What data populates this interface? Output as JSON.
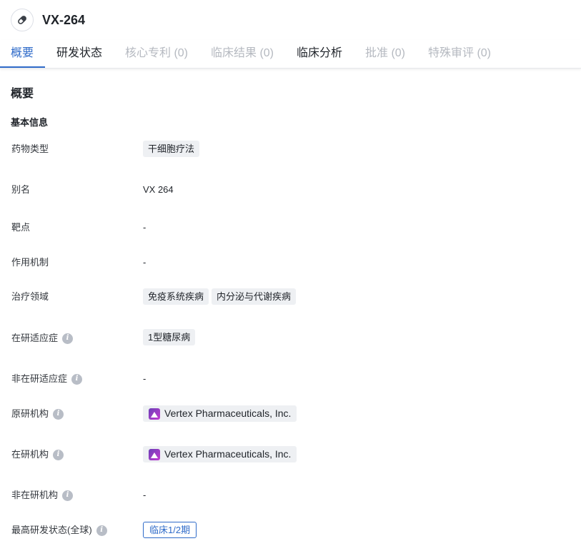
{
  "drug": {
    "name": "VX-264",
    "icon": "pill-icon"
  },
  "tabs": [
    {
      "label": "概要",
      "state": "active"
    },
    {
      "label": "研发状态",
      "state": "normal"
    },
    {
      "label": "核心专利 (0)",
      "state": "disabled"
    },
    {
      "label": "临床结果 (0)",
      "state": "disabled"
    },
    {
      "label": "临床分析",
      "state": "normal"
    },
    {
      "label": "批准 (0)",
      "state": "disabled"
    },
    {
      "label": "特殊审评 (0)",
      "state": "disabled"
    }
  ],
  "overview": {
    "section_title": "概要",
    "basic_info_title": "基本信息",
    "fields": {
      "drug_type": {
        "label": "药物类型",
        "tags": [
          "干细胞疗法"
        ]
      },
      "alias": {
        "label": "别名",
        "value": "VX 264"
      },
      "target": {
        "label": "靶点",
        "value": "-"
      },
      "mechanism": {
        "label": "作用机制",
        "value": "-"
      },
      "therapeutic_area": {
        "label": "治疗领域",
        "tags": [
          "免疫系统疾病",
          "内分泌与代谢疾病"
        ]
      },
      "active_indication": {
        "label": "在研适应症",
        "tags": [
          "1型糖尿病"
        ]
      },
      "inactive_indication": {
        "label": "非在研适应症",
        "value": "-"
      },
      "originator": {
        "label": "原研机构",
        "org": "Vertex Pharmaceuticals, Inc."
      },
      "active_org": {
        "label": "在研机构",
        "org": "Vertex Pharmaceuticals, Inc."
      },
      "inactive_org": {
        "label": "非在研机构",
        "value": "-"
      },
      "highest_phase": {
        "label": "最高研发状态(全球)",
        "phase": "临床1/2期"
      }
    }
  },
  "colors": {
    "accent": "#2f6bc9",
    "tag_bg": "#eef0f3",
    "disabled_text": "#b5b9c0"
  }
}
